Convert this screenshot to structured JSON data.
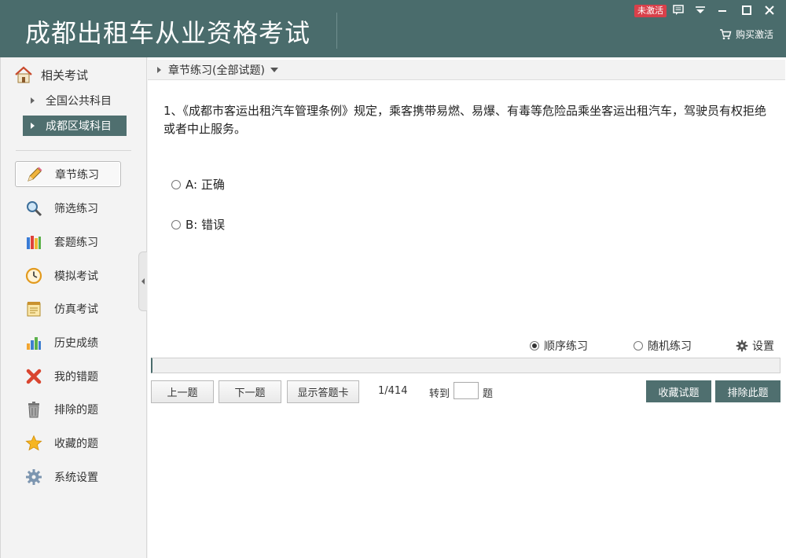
{
  "app": {
    "title": "成都出租车从业资格考试"
  },
  "header": {
    "status_badge": "未激活",
    "buy_label": "购买激活"
  },
  "sidebar": {
    "section_title": "相关考试",
    "subjects": [
      {
        "label": "全国公共科目"
      },
      {
        "label": "成都区域科目"
      }
    ],
    "nav": [
      {
        "label": "章节练习",
        "icon": "pencil-icon"
      },
      {
        "label": "筛选练习",
        "icon": "magnifier-icon"
      },
      {
        "label": "套题练习",
        "icon": "books-icon"
      },
      {
        "label": "模拟考试",
        "icon": "clock-icon"
      },
      {
        "label": "仿真考试",
        "icon": "notepad-icon"
      },
      {
        "label": "历史成绩",
        "icon": "bar-chart-icon"
      },
      {
        "label": "我的错题",
        "icon": "red-x-icon"
      },
      {
        "label": "排除的题",
        "icon": "trash-icon"
      },
      {
        "label": "收藏的题",
        "icon": "star-icon"
      },
      {
        "label": "系统设置",
        "icon": "gear-icon"
      }
    ]
  },
  "breadcrumb": {
    "label": "章节练习(全部试题)"
  },
  "question": {
    "text": "1、《成都市客运出租汽车管理条例》规定，乘客携带易燃、易爆、有毒等危险品乘坐客运出租汽车，驾驶员有权拒绝或者中止服务。",
    "options": [
      {
        "label": "A: 正确"
      },
      {
        "label": "B: 错误"
      }
    ]
  },
  "modes": {
    "sequential": "顺序练习",
    "random": "随机练习",
    "settings": "设置"
  },
  "controls": {
    "prev": "上一题",
    "next": "下一题",
    "answer_card": "显示答题卡",
    "counter": "1/414",
    "goto_label": "转到",
    "goto_value": "",
    "goto_suffix": "题",
    "favorite": "收藏试题",
    "exclude": "排除此题"
  },
  "colors": {
    "header_bg": "#4a6c6c",
    "active_bg": "#4f6f6f",
    "badge": "#d9404a"
  }
}
